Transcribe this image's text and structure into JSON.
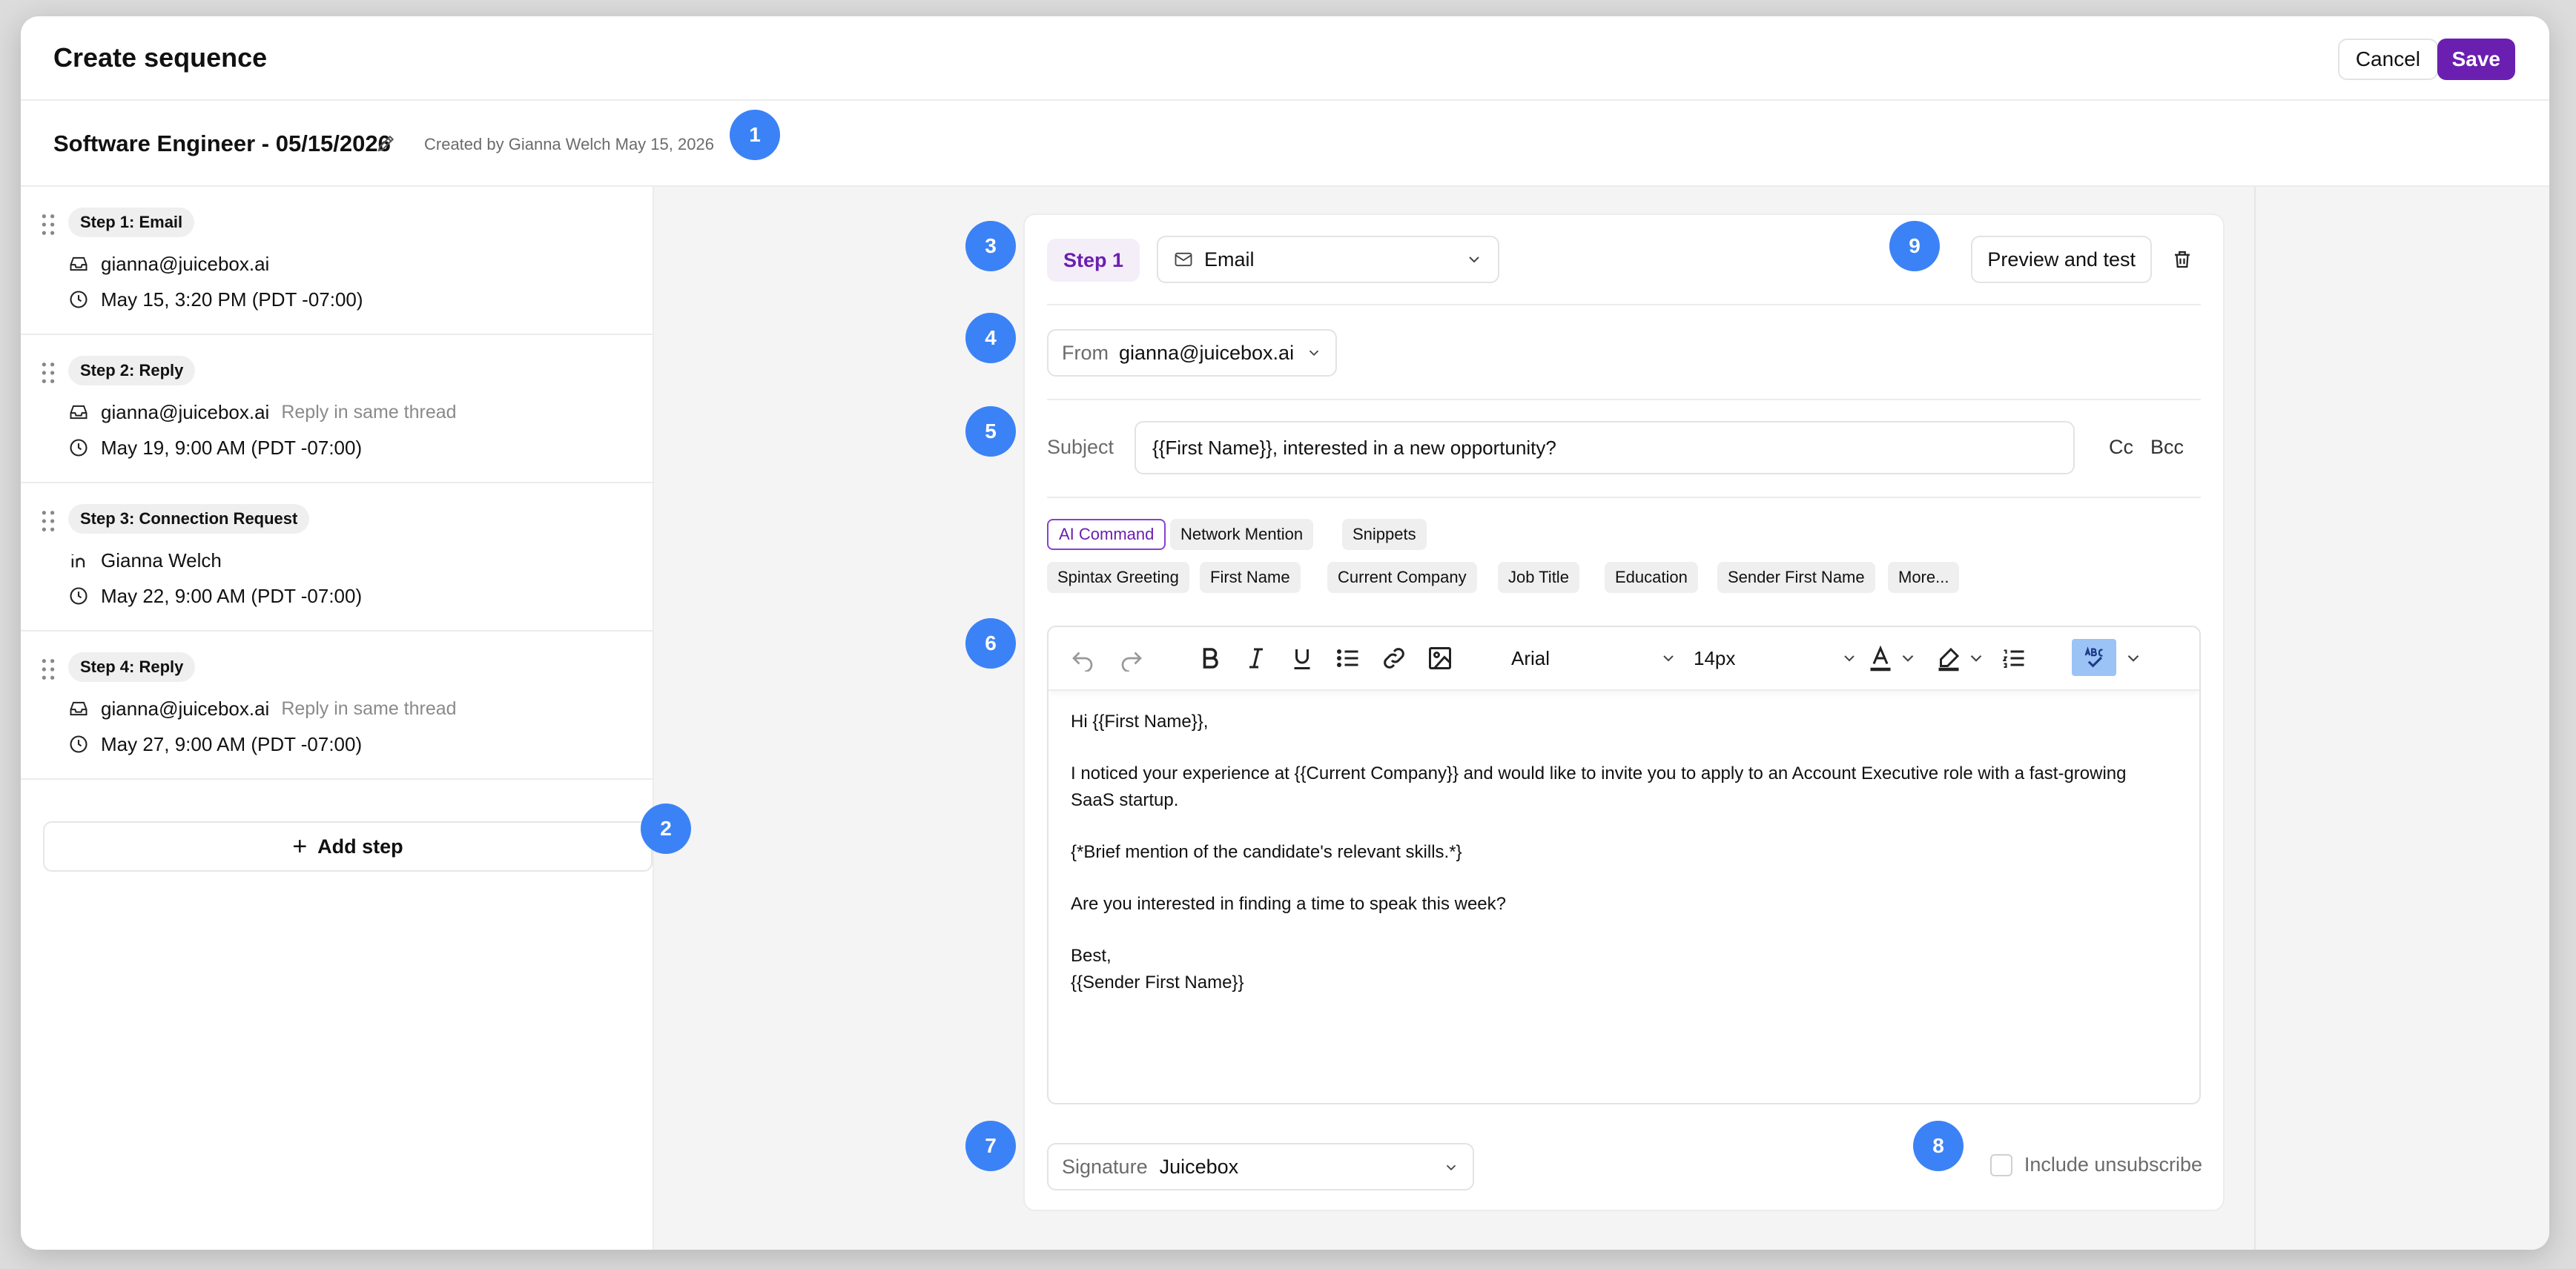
{
  "modal": {
    "title": "Create sequence",
    "cancel_label": "Cancel",
    "save_label": "Save"
  },
  "sequence": {
    "name": "Software Engineer - 05/15/2026",
    "created_text": "Created by Gianna Welch May 15, 2026"
  },
  "steps": [
    {
      "label": "Step 1: Email",
      "line1_icon": "inbox-icon",
      "line1": "gianna@juicebox.ai",
      "line1_extra": "",
      "line2": "May 15, 3:20 PM (PDT -07:00)"
    },
    {
      "label": "Step 2: Reply",
      "line1_icon": "inbox-icon",
      "line1": "gianna@juicebox.ai",
      "line1_extra": "Reply in same thread",
      "line2": "May 19, 9:00 AM (PDT -07:00)"
    },
    {
      "label": "Step 3: Connection Request",
      "line1_icon": "linkedin-icon",
      "line1": "Gianna Welch",
      "line1_extra": "",
      "line2": "May 22, 9:00 AM (PDT -07:00)"
    },
    {
      "label": "Step 4: Reply",
      "line1_icon": "inbox-icon",
      "line1": "gianna@juicebox.ai",
      "line1_extra": "Reply in same thread",
      "line2": "May 27, 9:00 AM (PDT -07:00)"
    }
  ],
  "add_step_label": "Add step",
  "editor": {
    "step_tag": "Step 1",
    "step_type": "Email",
    "preview_label": "Preview and test",
    "from_label": "From",
    "from_value": "gianna@juicebox.ai",
    "subject_label": "Subject",
    "subject_value": "{{First Name}}, interested in a new opportunity?",
    "cc_label": "Cc",
    "bcc_label": "Bcc",
    "chips_row1": [
      "AI Command",
      "Network Mention",
      "Snippets"
    ],
    "chips_row2": [
      "Spintax Greeting",
      "First Name",
      "Current Company",
      "Job Title",
      "Education",
      "Sender First Name",
      "More..."
    ],
    "font_family": "Arial",
    "font_size": "14px",
    "body": [
      "Hi {{First Name}},",
      "I noticed your experience at {{Current Company}} and would like to invite you to apply to an Account Executive role with a fast-growing SaaS startup.",
      "{*Brief mention of the candidate's relevant skills.*}",
      "Are you interested in finding a time to speak this week?",
      "Best,",
      "{{Sender First Name}}"
    ],
    "signature_label": "Signature",
    "signature_value": "Juicebox",
    "unsubscribe_label": "Include unsubscribe"
  },
  "badges": [
    "1",
    "2",
    "3",
    "4",
    "5",
    "6",
    "7",
    "8",
    "9"
  ],
  "colors": {
    "accent": "#6b1fb1",
    "badge": "#3b82f6"
  }
}
